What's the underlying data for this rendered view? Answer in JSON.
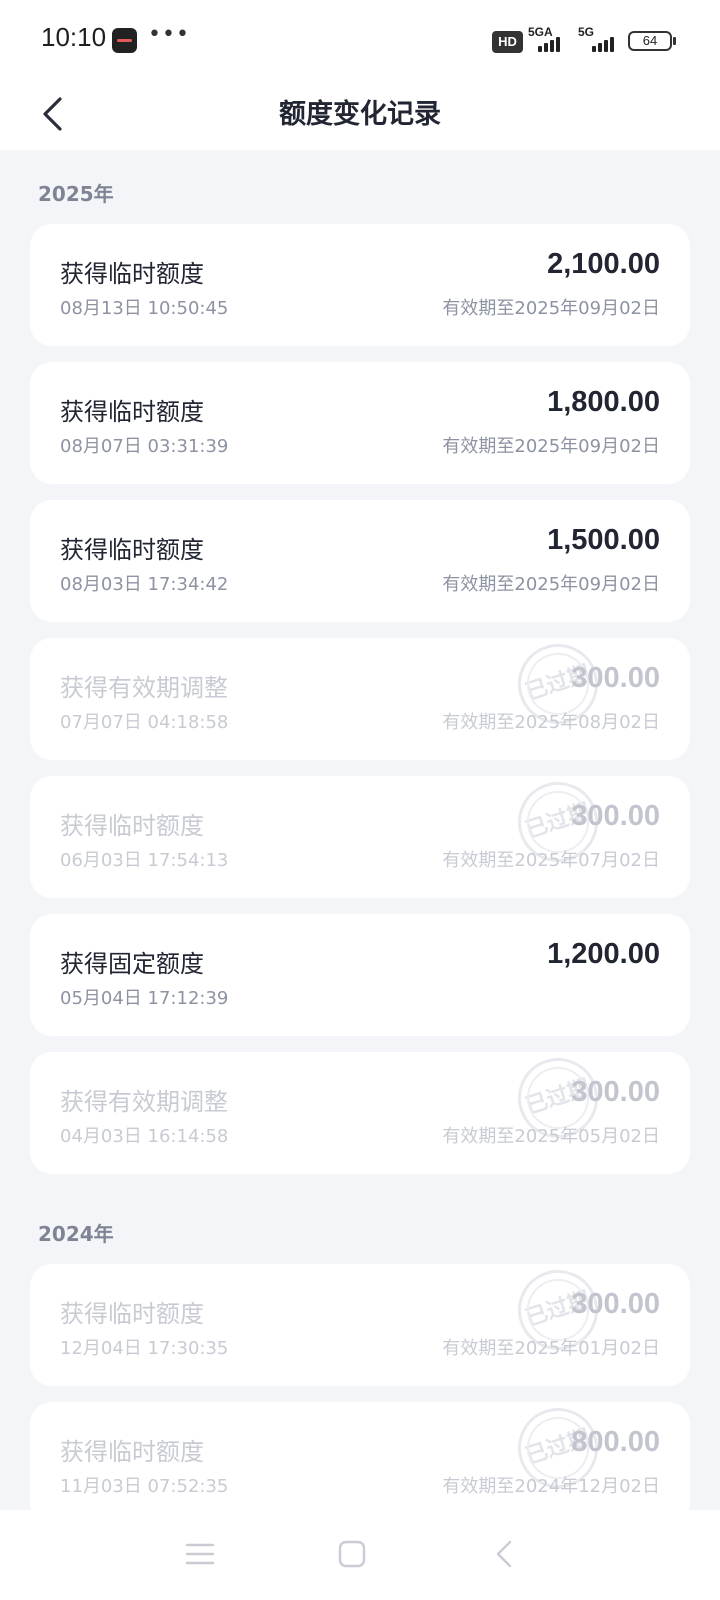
{
  "status_bar": {
    "time": "10:10",
    "dots": "•••",
    "hd": "HD",
    "net1": "5GA",
    "net2": "5G",
    "battery": "64"
  },
  "header": {
    "title": "额度变化记录"
  },
  "groups": [
    {
      "year": "2025年",
      "records": [
        {
          "title": "获得临时额度",
          "time": "08月13日 10:50:45",
          "amount": "2,100.00",
          "validity": "有效期至2025年09月02日"
        },
        {
          "title": "获得临时额度",
          "time": "08月07日 03:31:39",
          "amount": "1,800.00",
          "validity": "有效期至2025年09月02日"
        },
        {
          "title": "获得临时额度",
          "time": "08月03日 17:34:42",
          "amount": "1,500.00",
          "validity": "有效期至2025年09月02日"
        },
        {
          "title": "获得有效期调整",
          "time": "07月07日 04:18:58",
          "amount": "300.00",
          "validity": "有效期至2025年08月02日",
          "stamp": "已过期"
        },
        {
          "title": "获得临时额度",
          "time": "06月03日 17:54:13",
          "amount": "300.00",
          "validity": "有效期至2025年07月02日",
          "stamp": "已过期"
        },
        {
          "title": "获得固定额度",
          "time": "05月04日 17:12:39",
          "amount": "1,200.00",
          "validity": ""
        },
        {
          "title": "获得有效期调整",
          "time": "04月03日 16:14:58",
          "amount": "300.00",
          "validity": "有效期至2025年05月02日",
          "stamp": "已过期"
        }
      ]
    },
    {
      "year": "2024年",
      "records": [
        {
          "title": "获得临时额度",
          "time": "12月04日 17:30:35",
          "amount": "300.00",
          "validity": "有效期至2025年01月02日",
          "stamp": "已过期"
        },
        {
          "title": "获得临时额度",
          "time": "11月03日 07:52:35",
          "amount": "800.00",
          "validity": "有效期至2024年12月02日",
          "stamp": "已过期"
        }
      ]
    }
  ]
}
